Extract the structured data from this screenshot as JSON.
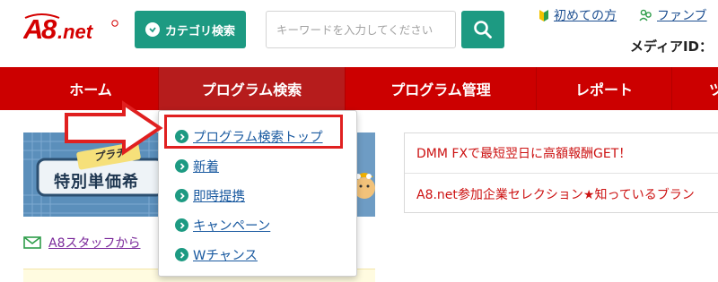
{
  "header": {
    "logo_text": "A8.net",
    "category_button_label": "カテゴリ検索",
    "search_placeholder": "キーワードを入力してください",
    "links": [
      {
        "label": "初めての方",
        "icon": "beginner-leaf-icon"
      },
      {
        "label": "ファンブ",
        "icon": "fan-icon"
      }
    ],
    "media_id_label": "メディアID："
  },
  "nav": {
    "items": [
      {
        "label": "ホーム",
        "active": false
      },
      {
        "label": "プログラム検索",
        "active": true
      },
      {
        "label": "プログラム管理",
        "active": false
      },
      {
        "label": "レポート",
        "active": false
      },
      {
        "label": "ツ",
        "active": false
      }
    ]
  },
  "dropdown": {
    "items": [
      {
        "label": "プログラム検索トップ",
        "highlighted": true
      },
      {
        "label": "新着",
        "highlighted": false
      },
      {
        "label": "即時提携",
        "highlighted": false
      },
      {
        "label": "キャンペーン",
        "highlighted": false
      },
      {
        "label": "Wチャンス",
        "highlighted": false
      }
    ]
  },
  "banner": {
    "tag": "プラチ",
    "title": "特別単価希"
  },
  "staff_link": {
    "label": "A8スタッフから",
    "icon": "mail-icon"
  },
  "news": [
    "DMM FXで最短翌日に高額報酬GET！",
    "A8.net参加企業セレクション★知っているブラン"
  ],
  "colors": {
    "brand_red": "#cc0000",
    "nav_active": "#b61c1c",
    "brand_green": "#1d9a82",
    "link_blue": "#1a5aa0",
    "highlight_red": "#e02020",
    "news_red": "#cc1111"
  }
}
